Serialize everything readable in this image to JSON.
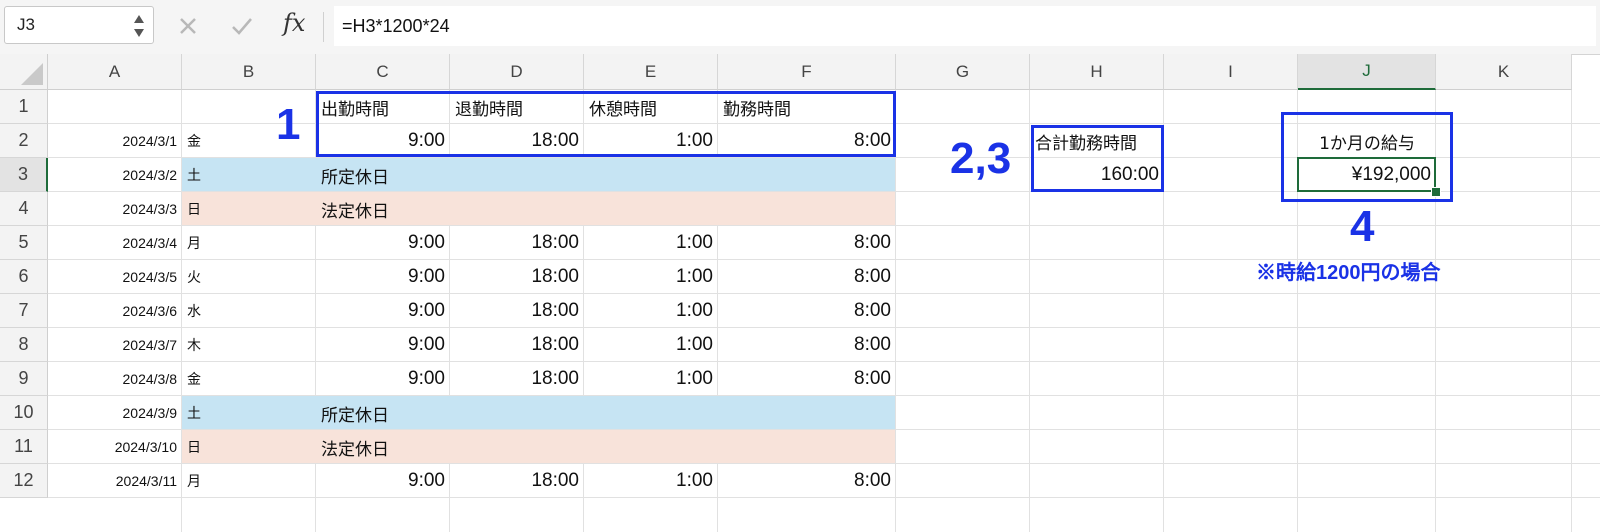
{
  "formula_bar": {
    "cell_ref": "J3",
    "fx_symbol": "fx",
    "formula": "=H3*1200*24"
  },
  "columns": [
    "A",
    "B",
    "C",
    "D",
    "E",
    "F",
    "G",
    "H",
    "I",
    "J",
    "K"
  ],
  "active_column": "J",
  "active_row": 3,
  "header_row": {
    "c": "出勤時間",
    "d": "退勤時間",
    "e": "休憩時間",
    "f": "勤務時間"
  },
  "rows": [
    {
      "num": "1"
    },
    {
      "num": "2",
      "date": "2024/3/1",
      "day": "金",
      "c": "9:00",
      "d": "18:00",
      "e": "1:00",
      "f": "8:00"
    },
    {
      "num": "3",
      "date": "2024/3/2",
      "day": "土",
      "holiday": "所定休日",
      "type": "scheduled"
    },
    {
      "num": "4",
      "date": "2024/3/3",
      "day": "日",
      "holiday": "法定休日",
      "type": "legal"
    },
    {
      "num": "5",
      "date": "2024/3/4",
      "day": "月",
      "c": "9:00",
      "d": "18:00",
      "e": "1:00",
      "f": "8:00"
    },
    {
      "num": "6",
      "date": "2024/3/5",
      "day": "火",
      "c": "9:00",
      "d": "18:00",
      "e": "1:00",
      "f": "8:00"
    },
    {
      "num": "7",
      "date": "2024/3/6",
      "day": "水",
      "c": "9:00",
      "d": "18:00",
      "e": "1:00",
      "f": "8:00"
    },
    {
      "num": "8",
      "date": "2024/3/7",
      "day": "木",
      "c": "9:00",
      "d": "18:00",
      "e": "1:00",
      "f": "8:00"
    },
    {
      "num": "9",
      "date": "2024/3/8",
      "day": "金",
      "c": "9:00",
      "d": "18:00",
      "e": "1:00",
      "f": "8:00"
    },
    {
      "num": "10",
      "date": "2024/3/9",
      "day": "土",
      "holiday": "所定休日",
      "type": "scheduled"
    },
    {
      "num": "11",
      "date": "2024/3/10",
      "day": "日",
      "holiday": "法定休日",
      "type": "legal"
    },
    {
      "num": "12",
      "date": "2024/3/11",
      "day": "月",
      "c": "9:00",
      "d": "18:00",
      "e": "1:00",
      "f": "8:00"
    }
  ],
  "summary": {
    "total_label": "合計勤務時間",
    "total_value": "160:00",
    "salary_label": "1か月の給与",
    "salary_value": "¥192,000"
  },
  "annotations": {
    "one": "1",
    "two_three": "2,3",
    "four": "4",
    "note": "※時給1200円の場合"
  },
  "colors": {
    "scheduled_holiday": "#c6e4f3",
    "legal_holiday": "#f8e3da",
    "annotation_blue": "#1a32e6",
    "selection_green": "#1e6b3a"
  }
}
